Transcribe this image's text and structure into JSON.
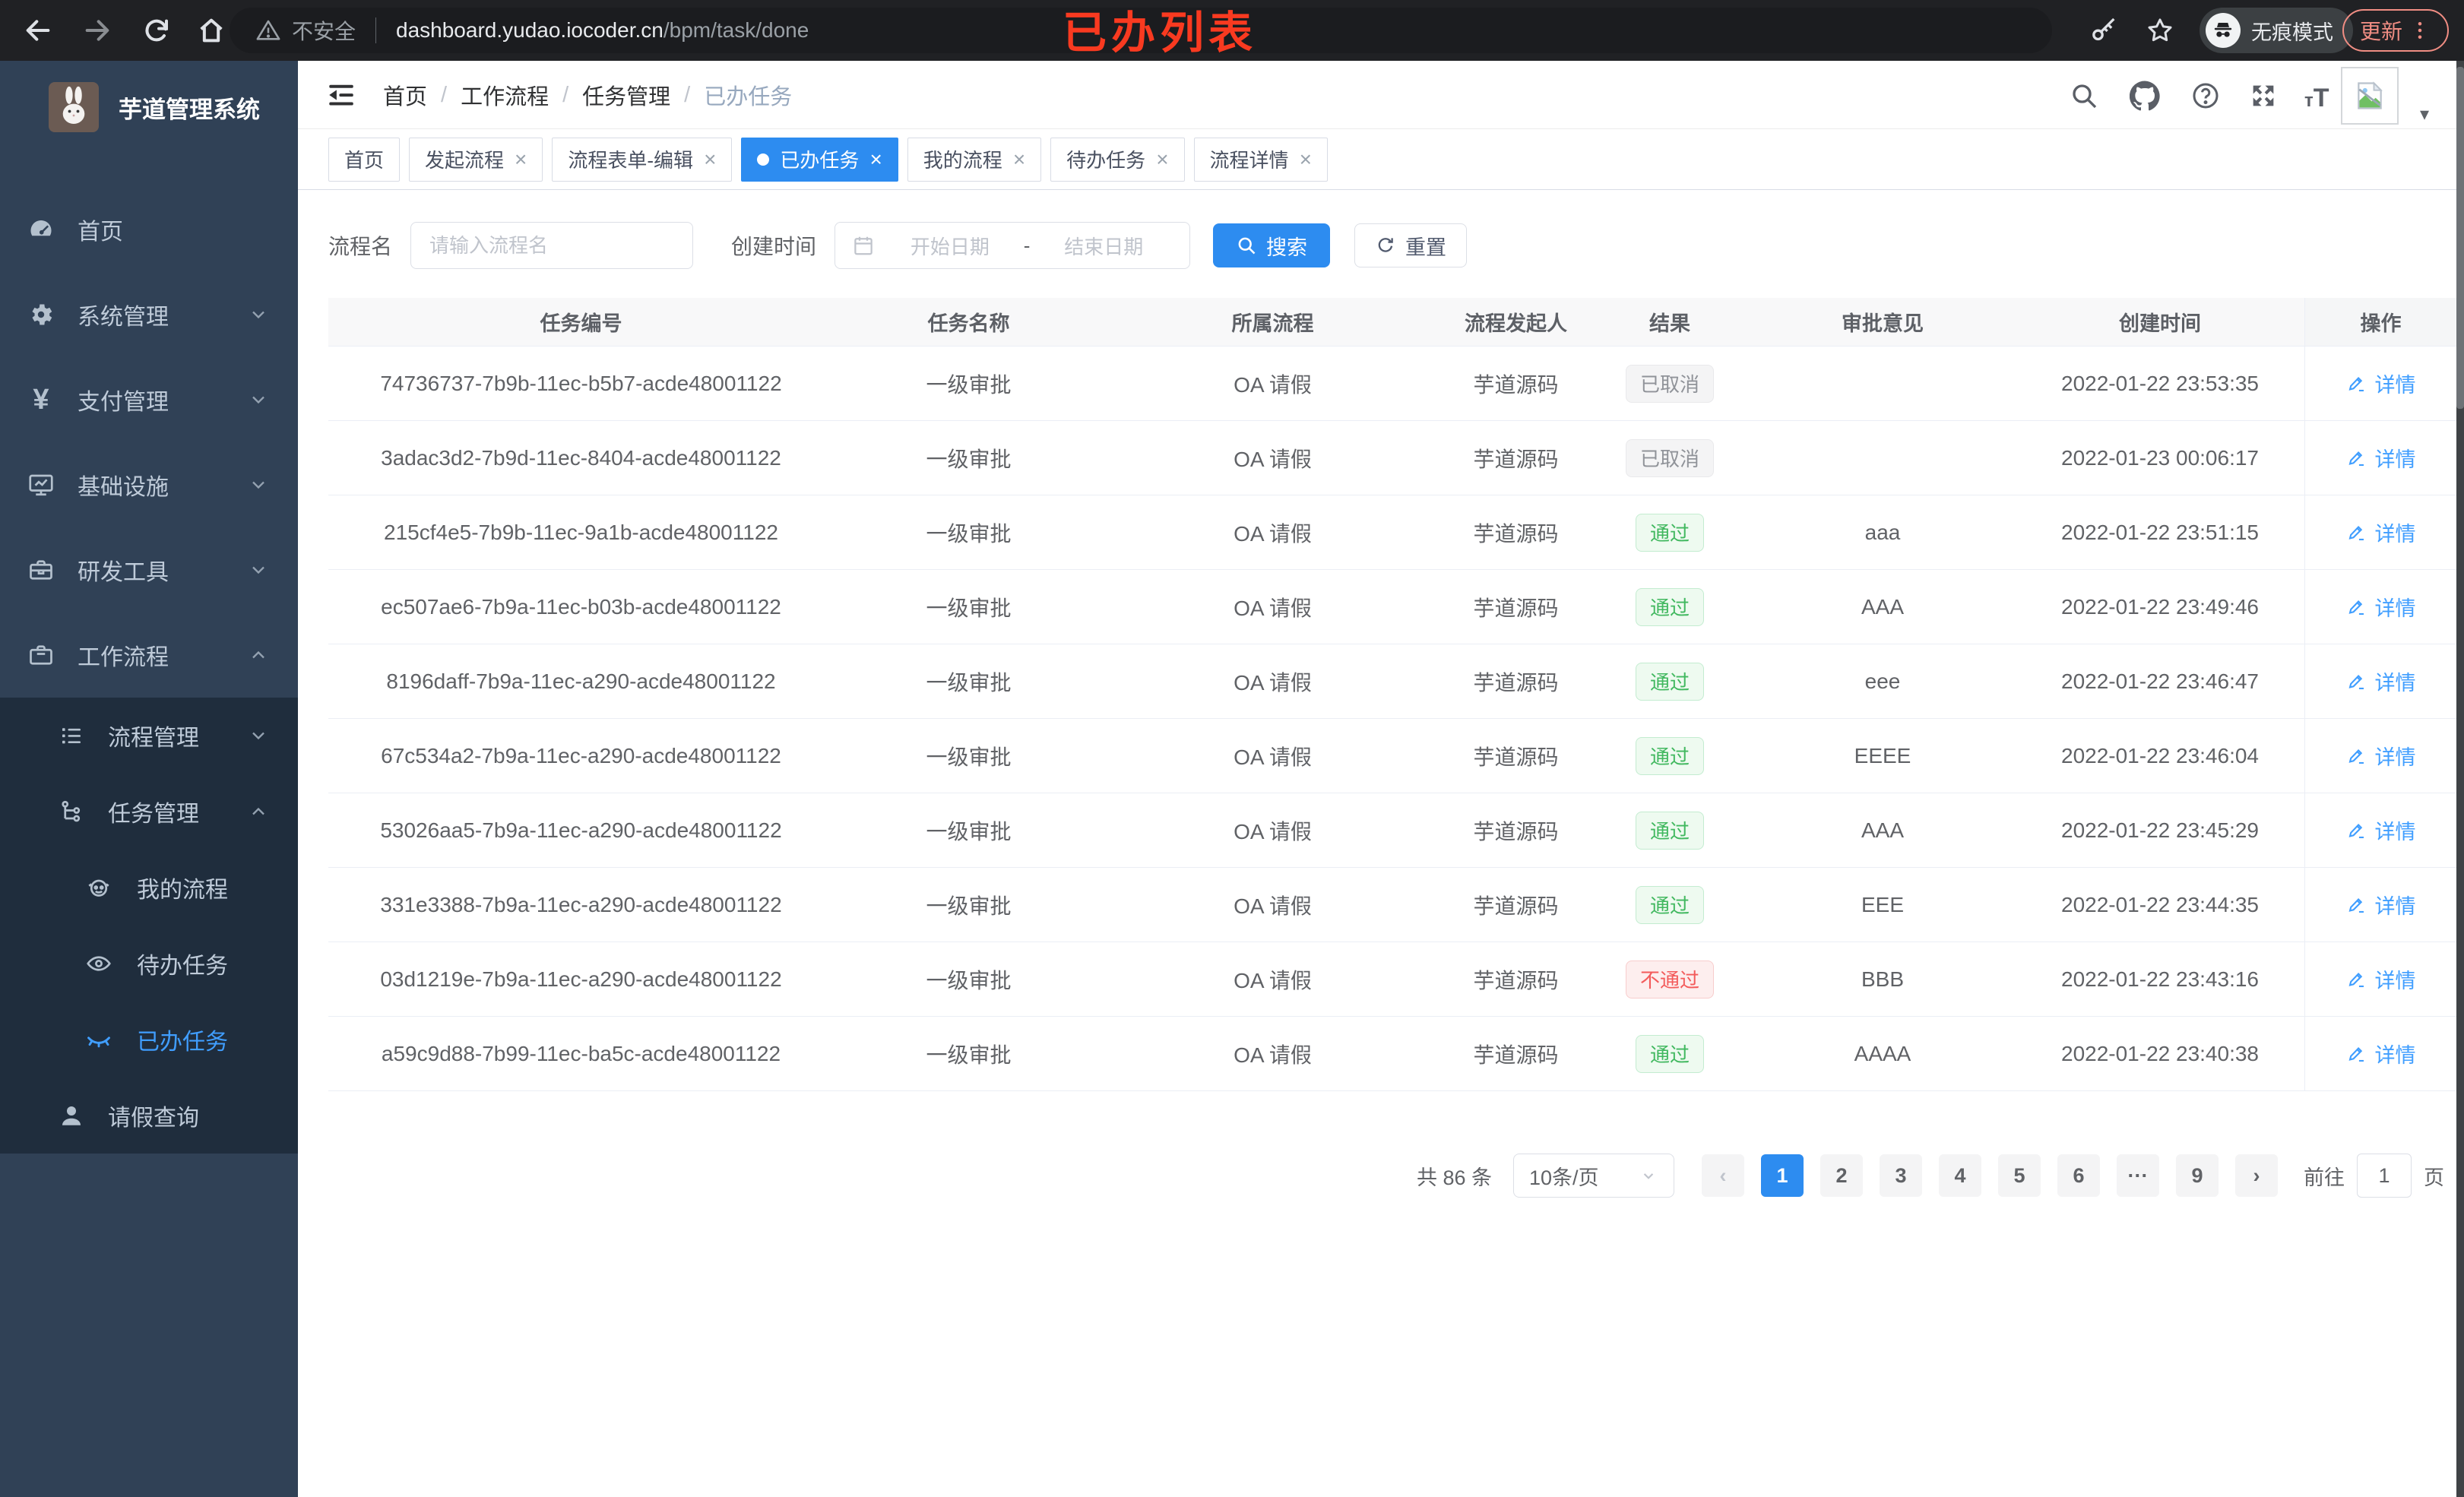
{
  "colors": {
    "primary": "#2d8cf0",
    "link": "#409eff",
    "success": "#41b85f",
    "danger": "#f35b5b",
    "info": "#909399",
    "sidebar_bg": "#304156",
    "submenu_bg": "#1f2d3d"
  },
  "browser": {
    "annotation": "已办列表",
    "security_label": "不安全",
    "url_host": "dashboard.yudao.iocoder.cn",
    "url_path": "/bpm/task/done",
    "incognito_label": "无痕模式",
    "update_label": "更新"
  },
  "sidebar": {
    "title": "芋道管理系统",
    "menu": [
      {
        "name": "home",
        "label": "首页",
        "icon": "dashboard-icon",
        "level": 1
      },
      {
        "name": "system",
        "label": "系统管理",
        "icon": "gear-icon",
        "level": 1,
        "chevron": "down"
      },
      {
        "name": "payment",
        "label": "支付管理",
        "icon": "yen-icon",
        "level": 1,
        "chevron": "down"
      },
      {
        "name": "infra",
        "label": "基础设施",
        "icon": "monitor-icon",
        "level": 1,
        "chevron": "down"
      },
      {
        "name": "devtools",
        "label": "研发工具",
        "icon": "toolbox-icon",
        "level": 1,
        "chevron": "down"
      },
      {
        "name": "workflow",
        "label": "工作流程",
        "icon": "briefcase-icon",
        "level": 1,
        "chevron": "up"
      },
      {
        "name": "process-mgmt",
        "label": "流程管理",
        "icon": "list-icon",
        "level": 2,
        "chevron": "down",
        "sub": true
      },
      {
        "name": "task-mgmt",
        "label": "任务管理",
        "icon": "flow-icon",
        "level": 2,
        "chevron": "up",
        "sub": true
      },
      {
        "name": "my-process",
        "label": "我的流程",
        "icon": "robot-icon",
        "level": 3,
        "sub": true
      },
      {
        "name": "todo-tasks",
        "label": "待办任务",
        "icon": "eye-icon",
        "level": 3,
        "sub": true
      },
      {
        "name": "done-tasks",
        "label": "已办任务",
        "icon": "eye-closed-icon",
        "level": 3,
        "sub": true,
        "active": true
      },
      {
        "name": "leave-query",
        "label": "请假查询",
        "icon": "user-icon",
        "level": 2,
        "sub": true
      }
    ]
  },
  "header": {
    "breadcrumb": [
      "首页",
      "工作流程",
      "任务管理",
      "已办任务"
    ]
  },
  "tabs": [
    {
      "name": "home",
      "label": "首页"
    },
    {
      "name": "start-process",
      "label": "发起流程",
      "closable": true
    },
    {
      "name": "form-edit",
      "label": "流程表单-编辑",
      "closable": true
    },
    {
      "name": "done-tasks",
      "label": "已办任务",
      "closable": true,
      "active": true
    },
    {
      "name": "my-process",
      "label": "我的流程",
      "closable": true
    },
    {
      "name": "todo-tasks",
      "label": "待办任务",
      "closable": true
    },
    {
      "name": "process-detail",
      "label": "流程详情",
      "closable": true
    }
  ],
  "filters": {
    "name_label": "流程名",
    "name_placeholder": "请输入流程名",
    "time_label": "创建时间",
    "start_placeholder": "开始日期",
    "range_separator": "-",
    "end_placeholder": "结束日期",
    "search_label": "搜索",
    "reset_label": "重置"
  },
  "table": {
    "columns": [
      "任务编号",
      "任务名称",
      "所属流程",
      "流程发起人",
      "结果",
      "审批意见",
      "创建时间",
      "操作"
    ],
    "action_label": "详情",
    "rows": [
      {
        "id": "74736737-7b9b-11ec-b5b7-acde48001122",
        "name": "一级审批",
        "process": "OA 请假",
        "initiator": "芋道源码",
        "result": "已取消",
        "result_type": "cancel",
        "comment": "",
        "time": "2022-01-22 23:53:35"
      },
      {
        "id": "3adac3d2-7b9d-11ec-8404-acde48001122",
        "name": "一级审批",
        "process": "OA 请假",
        "initiator": "芋道源码",
        "result": "已取消",
        "result_type": "cancel",
        "comment": "",
        "time": "2022-01-23 00:06:17"
      },
      {
        "id": "215cf4e5-7b9b-11ec-9a1b-acde48001122",
        "name": "一级审批",
        "process": "OA 请假",
        "initiator": "芋道源码",
        "result": "通过",
        "result_type": "pass",
        "comment": "aaa",
        "time": "2022-01-22 23:51:15"
      },
      {
        "id": "ec507ae6-7b9a-11ec-b03b-acde48001122",
        "name": "一级审批",
        "process": "OA 请假",
        "initiator": "芋道源码",
        "result": "通过",
        "result_type": "pass",
        "comment": "AAA",
        "time": "2022-01-22 23:49:46"
      },
      {
        "id": "8196daff-7b9a-11ec-a290-acde48001122",
        "name": "一级审批",
        "process": "OA 请假",
        "initiator": "芋道源码",
        "result": "通过",
        "result_type": "pass",
        "comment": "eee",
        "time": "2022-01-22 23:46:47"
      },
      {
        "id": "67c534a2-7b9a-11ec-a290-acde48001122",
        "name": "一级审批",
        "process": "OA 请假",
        "initiator": "芋道源码",
        "result": "通过",
        "result_type": "pass",
        "comment": "EEEE",
        "time": "2022-01-22 23:46:04"
      },
      {
        "id": "53026aa5-7b9a-11ec-a290-acde48001122",
        "name": "一级审批",
        "process": "OA 请假",
        "initiator": "芋道源码",
        "result": "通过",
        "result_type": "pass",
        "comment": "AAA",
        "time": "2022-01-22 23:45:29"
      },
      {
        "id": "331e3388-7b9a-11ec-a290-acde48001122",
        "name": "一级审批",
        "process": "OA 请假",
        "initiator": "芋道源码",
        "result": "通过",
        "result_type": "pass",
        "comment": "EEE",
        "time": "2022-01-22 23:44:35"
      },
      {
        "id": "03d1219e-7b9a-11ec-a290-acde48001122",
        "name": "一级审批",
        "process": "OA 请假",
        "initiator": "芋道源码",
        "result": "不通过",
        "result_type": "fail",
        "comment": "BBB",
        "time": "2022-01-22 23:43:16"
      },
      {
        "id": "a59c9d88-7b99-11ec-ba5c-acde48001122",
        "name": "一级审批",
        "process": "OA 请假",
        "initiator": "芋道源码",
        "result": "通过",
        "result_type": "pass",
        "comment": "AAAA",
        "time": "2022-01-22 23:40:38"
      }
    ]
  },
  "pagination": {
    "total_label": "共 86 条",
    "page_size_label": "10条/页",
    "pages": [
      "1",
      "2",
      "3",
      "4",
      "5",
      "6",
      "···",
      "9"
    ],
    "current_page": "1",
    "goto_label": "前往",
    "goto_value": "1",
    "page_unit_label": "页"
  }
}
